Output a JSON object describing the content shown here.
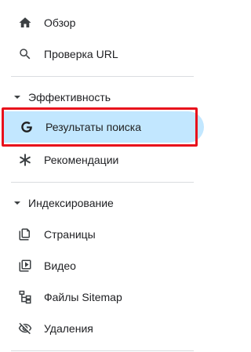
{
  "nav": {
    "top_items": [
      {
        "label": "Обзор",
        "icon": "home-icon"
      },
      {
        "label": "Проверка URL",
        "icon": "search-icon"
      }
    ],
    "sections": [
      {
        "title": "Эффективность",
        "items": [
          {
            "label": "Результаты поиска",
            "icon": "google-g-icon",
            "active": true
          },
          {
            "label": "Рекомендации",
            "icon": "asterisk-icon"
          }
        ]
      },
      {
        "title": "Индексирование",
        "items": [
          {
            "label": "Страницы",
            "icon": "pages-icon"
          },
          {
            "label": "Видео",
            "icon": "video-icon"
          },
          {
            "label": "Файлы Sitemap",
            "icon": "sitemap-icon"
          },
          {
            "label": "Удаления",
            "icon": "removals-icon"
          }
        ]
      }
    ]
  },
  "colors": {
    "active_bg": "#c2e7ff",
    "highlight_border": "#e8101c",
    "text": "#202124",
    "divider": "#dadce0"
  }
}
